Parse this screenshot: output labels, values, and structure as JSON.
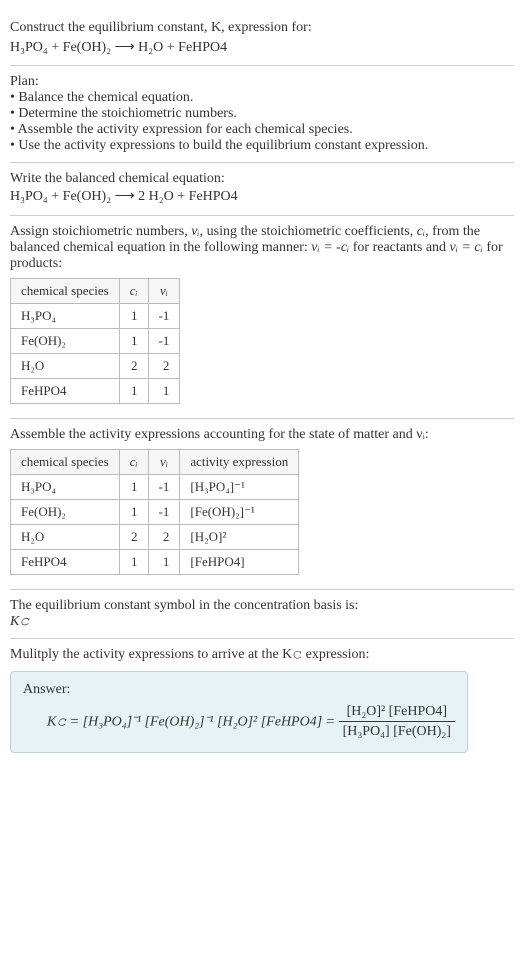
{
  "prompt": {
    "line1": "Construct the equilibrium constant, K, expression for:",
    "line2": "H₃PO₄ + Fe(OH)₂ ⟶ H₂O + FeHPO4"
  },
  "plan": {
    "heading": "Plan:",
    "items": [
      "• Balance the chemical equation.",
      "• Determine the stoichiometric numbers.",
      "• Assemble the activity expression for each chemical species.",
      "• Use the activity expressions to build the equilibrium constant expression."
    ]
  },
  "balanced": {
    "heading": "Write the balanced chemical equation:",
    "equation": "H₃PO₄ + Fe(OH)₂ ⟶ 2 H₂O + FeHPO4"
  },
  "stoich": {
    "intro_before": "Assign stoichiometric numbers, ",
    "vi": "νᵢ",
    "intro_mid1": ", using the stoichiometric coefficients, ",
    "ci": "cᵢ",
    "intro_mid2": ", from the balanced chemical equation in the following manner: ",
    "rel1": "νᵢ = -cᵢ",
    "intro_mid3": " for reactants and ",
    "rel2": "νᵢ = cᵢ",
    "intro_end": " for products:",
    "headers": {
      "species": "chemical species",
      "ci": "cᵢ",
      "vi": "νᵢ"
    },
    "rows": [
      {
        "species": "H₃PO₄",
        "ci": "1",
        "vi": "-1"
      },
      {
        "species": "Fe(OH)₂",
        "ci": "1",
        "vi": "-1"
      },
      {
        "species": "H₂O",
        "ci": "2",
        "vi": "2"
      },
      {
        "species": "FeHPO4",
        "ci": "1",
        "vi": "1"
      }
    ]
  },
  "activity": {
    "intro": "Assemble the activity expressions accounting for the state of matter and νᵢ:",
    "headers": {
      "species": "chemical species",
      "ci": "cᵢ",
      "vi": "νᵢ",
      "expr": "activity expression"
    },
    "rows": [
      {
        "species": "H₃PO₄",
        "ci": "1",
        "vi": "-1",
        "expr": "[H₃PO₄]⁻¹"
      },
      {
        "species": "Fe(OH)₂",
        "ci": "1",
        "vi": "-1",
        "expr": "[Fe(OH)₂]⁻¹"
      },
      {
        "species": "H₂O",
        "ci": "2",
        "vi": "2",
        "expr": "[H₂O]²"
      },
      {
        "species": "FeHPO4",
        "ci": "1",
        "vi": "1",
        "expr": "[FeHPO4]"
      }
    ]
  },
  "kc_symbol": {
    "line1": "The equilibrium constant symbol in the concentration basis is:",
    "line2": "K𝚌"
  },
  "multiply": {
    "heading": "Mulitply the activity expressions to arrive at the K𝚌 expression:"
  },
  "answer": {
    "label": "Answer:",
    "lhs": "K𝚌 = [H₃PO₄]⁻¹ [Fe(OH)₂]⁻¹ [H₂O]² [FeHPO4] = ",
    "frac_num": "[H₂O]² [FeHPO4]",
    "frac_den": "[H₃PO₄] [Fe(OH)₂]"
  }
}
